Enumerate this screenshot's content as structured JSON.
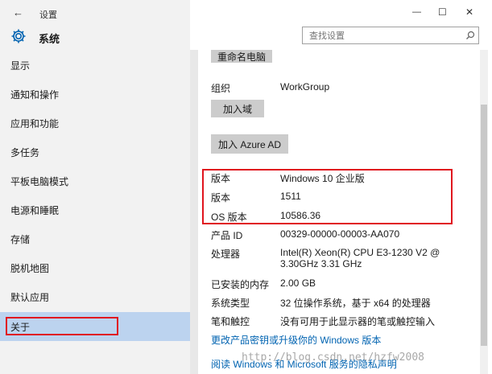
{
  "titlebar": {
    "back": "←",
    "title": "设置",
    "minimize": "—",
    "maximize": "☐",
    "close": "✕"
  },
  "header": {
    "title": "系统",
    "icon": "gear-icon"
  },
  "search": {
    "placeholder": "查找设置",
    "icon": "search-icon"
  },
  "sidebar": {
    "items": [
      {
        "label": "显示"
      },
      {
        "label": "通知和操作"
      },
      {
        "label": "应用和功能"
      },
      {
        "label": "多任务"
      },
      {
        "label": "平板电脑模式"
      },
      {
        "label": "电源和睡眠"
      },
      {
        "label": "存储"
      },
      {
        "label": "脱机地图"
      },
      {
        "label": "默认应用"
      },
      {
        "label": "关于"
      }
    ],
    "selected_index": 9
  },
  "main": {
    "rename_button": "重命名电脑",
    "org_label": "组织",
    "org_value": "WorkGroup",
    "join_domain_button": "加入域",
    "join_azure_button": "加入 Azure AD",
    "specs": [
      {
        "label": "版本",
        "value": "Windows 10 企业版"
      },
      {
        "label": "版本",
        "value": "1511"
      },
      {
        "label": "OS 版本",
        "value": "10586.36"
      },
      {
        "label": "产品 ID",
        "value": "00329-00000-00003-AA070"
      },
      {
        "label": "处理器",
        "value": "Intel(R) Xeon(R) CPU E3-1230 V2 @",
        "value2": "3.30GHz   3.31 GHz"
      },
      {
        "label": "已安装的内存",
        "value": "2.00 GB"
      },
      {
        "label": "系统类型",
        "value": "32 位操作系统，基于 x64 的处理器"
      },
      {
        "label": "笔和触控",
        "value": "没有可用于此显示器的笔或触控输入"
      }
    ],
    "link1": "更改产品密钥或升级你的 Windows 版本",
    "link2": "阅读 Windows 和 Microsoft 服务的隐私声明"
  },
  "watermark": "http://blog.csdn.net/hzfw2008",
  "colors": {
    "accent": "#0063b1",
    "highlight_red": "#e0141e",
    "selected_bg": "#bcd3ef"
  }
}
